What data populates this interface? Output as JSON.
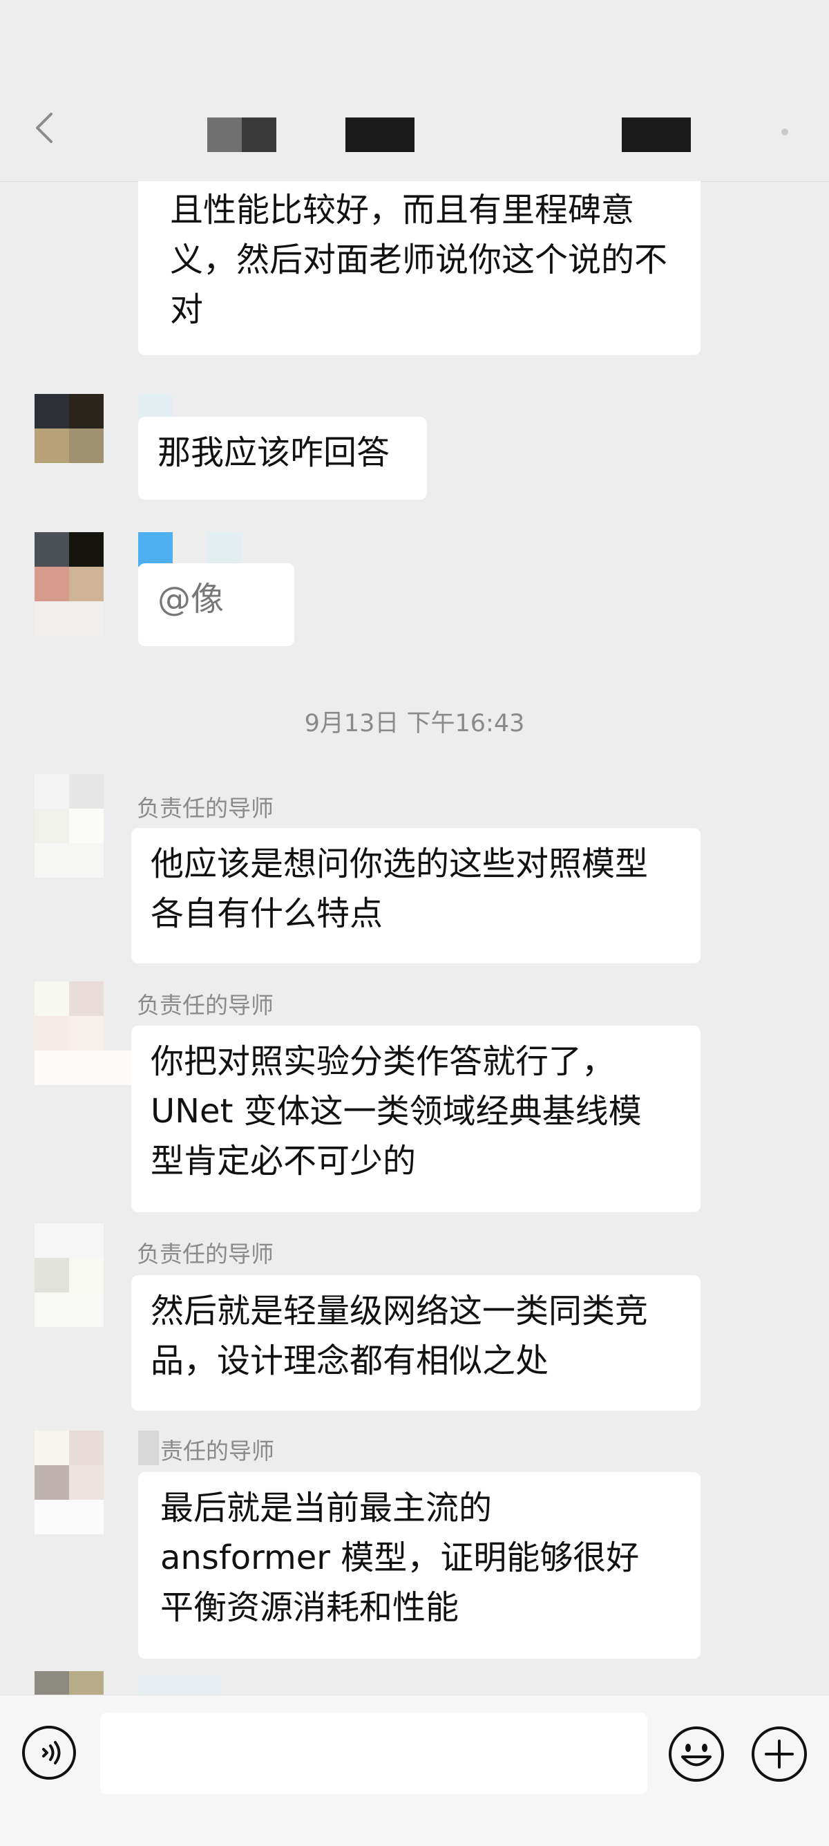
{
  "header": {
    "back_icon": "chevron-left-icon",
    "title_redacted": true,
    "more_icon": "dot-icon"
  },
  "timestamp": "9月13日 下午16:43",
  "messages": [
    {
      "sender": "",
      "text": "且性能比较好，而且有里程碑意\n义，然后对面老师说你这个说的不\n对"
    },
    {
      "sender": "",
      "text": "那我应该咋回答"
    },
    {
      "sender": "",
      "text": "@像"
    },
    {
      "sender": "负责任的导师",
      "text": "他应该是想问你选的这些对照模型\n各自有什么特点"
    },
    {
      "sender": "负责任的导师",
      "text": "你把对照实验分类作答就行了，\nUNet 变体这一类领域经典基线模\n型肯定必不可少的"
    },
    {
      "sender": "负责任的导师",
      "text": "然后就是轻量级网络这一类同类竞\n品，设计理念都有相似之处"
    },
    {
      "sender": "责任的导师",
      "text": "最后就是当前最主流的\nansformer 模型，证明能够很好\n平衡资源消耗和性能"
    }
  ],
  "input_bar": {
    "voice_icon": "voice-icon",
    "input_value": "",
    "emoji_icon": "emoji-icon",
    "add_icon": "plus-icon"
  },
  "colors": {
    "background": "#ededed",
    "bubble": "#ffffff",
    "meta_text": "#8a8a8a"
  }
}
